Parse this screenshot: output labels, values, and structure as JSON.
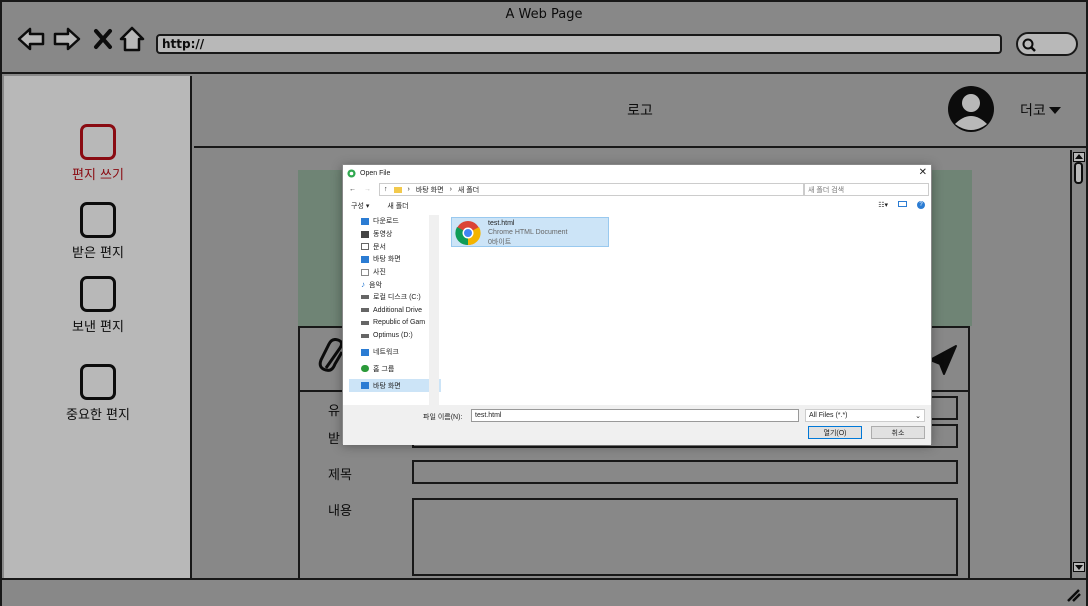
{
  "browser": {
    "title": "A Web Page",
    "url": "http://"
  },
  "sidebar": {
    "items": [
      {
        "label": "편지 쓰기",
        "active": true
      },
      {
        "label": "받은 편지",
        "active": false
      },
      {
        "label": "보낸 편지",
        "active": false
      },
      {
        "label": "중요한 편지",
        "active": false
      }
    ]
  },
  "header": {
    "logo": "로고",
    "more": "더코"
  },
  "compose": {
    "fields": [
      {
        "label": "유"
      },
      {
        "label": "받"
      },
      {
        "label": "제목"
      },
      {
        "label": "내용"
      }
    ]
  },
  "dialog": {
    "title": "Open File",
    "breadcrumb": [
      "바탕 화면",
      "새 폴더"
    ],
    "search_placeholder": "새 폴더 검색",
    "organize": "구성 ▾",
    "new_folder": "새 폴더",
    "tree": [
      {
        "label": "다운로드",
        "icon": "download-icon",
        "color": "#2b7cd3"
      },
      {
        "label": "동영상",
        "icon": "video-icon",
        "color": "#444444"
      },
      {
        "label": "문서",
        "icon": "document-icon",
        "color": "#666666"
      },
      {
        "label": "바탕 화면",
        "icon": "desktop-icon",
        "color": "#2b7cd3"
      },
      {
        "label": "사진",
        "icon": "pictures-icon",
        "color": "#888888"
      },
      {
        "label": "음악",
        "icon": "music-icon",
        "color": "#2b7cd3"
      },
      {
        "label": "로컬 디스크 (C:)",
        "icon": "drive-icon",
        "color": "#666666"
      },
      {
        "label": "Additional Drive",
        "icon": "drive-icon",
        "color": "#666666"
      },
      {
        "label": "Republic of Gam",
        "icon": "drive-icon",
        "color": "#666666"
      },
      {
        "label": "Optimus (D:)",
        "icon": "drive-icon",
        "color": "#666666"
      },
      {
        "label": "네트워크",
        "icon": "network-icon",
        "color": "#2b7cd3"
      },
      {
        "label": "홈 그룹",
        "icon": "homegroup-icon",
        "color": "#2b9a3a"
      },
      {
        "label": "바탕 화면",
        "icon": "desktop-icon",
        "color": "#2b7cd3",
        "selected": true
      }
    ],
    "file": {
      "name": "test.html",
      "type": "Chrome HTML Document",
      "size": "0바이트"
    },
    "filename_label": "파일 이름(N):",
    "filename_value": "test.html",
    "filetype": "All Files (*.*)",
    "open_button": "열기(O)",
    "cancel_button": "취소"
  }
}
